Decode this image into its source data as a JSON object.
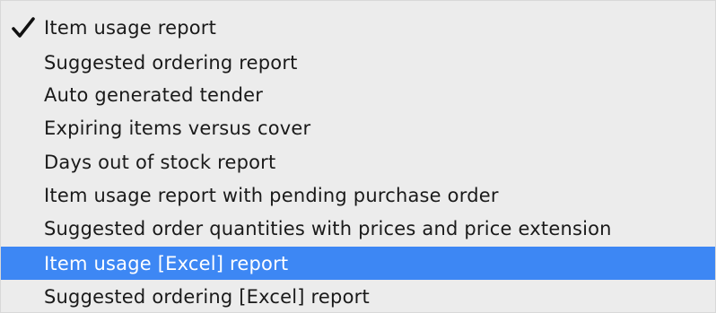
{
  "menu": {
    "items": [
      {
        "label": "Item usage report",
        "checked": true,
        "highlighted": false
      },
      {
        "label": "Suggested ordering report",
        "checked": false,
        "highlighted": false
      },
      {
        "label": "Auto generated tender",
        "checked": false,
        "highlighted": false
      },
      {
        "label": "Expiring items versus cover",
        "checked": false,
        "highlighted": false
      },
      {
        "label": "Days out of stock report",
        "checked": false,
        "highlighted": false
      },
      {
        "label": "Item usage report with pending purchase order",
        "checked": false,
        "highlighted": false
      },
      {
        "label": "Suggested order quantities with prices and price extension",
        "checked": false,
        "highlighted": false
      },
      {
        "label": "Item usage [Excel] report",
        "checked": false,
        "highlighted": true
      },
      {
        "label": "Suggested ordering [Excel] report",
        "checked": false,
        "highlighted": false
      }
    ],
    "checkmark_icon": "checkmark-icon",
    "highlight_color": "#3d87f4",
    "background_color": "#ececec"
  }
}
